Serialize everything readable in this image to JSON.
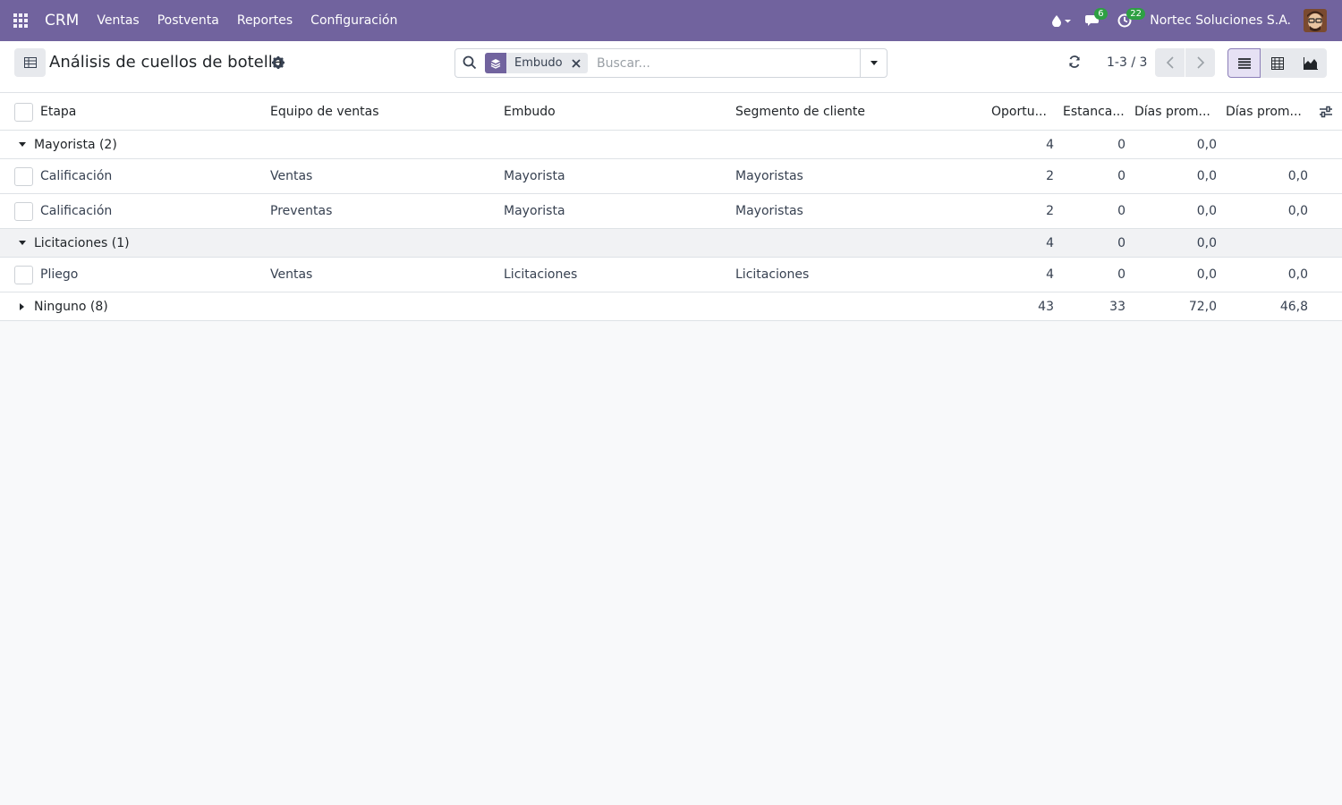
{
  "navbar": {
    "brand": "CRM",
    "menus": [
      "Ventas",
      "Postventa",
      "Reportes",
      "Configuración"
    ],
    "messages_count": "6",
    "activities_count": "22",
    "company": "Nortec Soluciones S.A.",
    "icons": [
      "apps-grid-icon",
      "droplet-icon",
      "chat-icon",
      "clock-icon",
      "avatar"
    ]
  },
  "control": {
    "title": "Análisis de cuellos de botella",
    "search": {
      "facet_label": "Embudo",
      "placeholder": "Buscar..."
    },
    "pager": "1-3 / 3",
    "views": [
      "list",
      "pivot",
      "graph"
    ],
    "active_view": "list"
  },
  "table": {
    "columns": [
      "Etapa",
      "Equipo de ventas",
      "Embudo",
      "Segmento de cliente",
      "Oportu...",
      "Estanca...",
      "Días prom...",
      "Días prom..."
    ],
    "groups": [
      {
        "label": "Mayorista (2)",
        "expanded": true,
        "totals": [
          "4",
          "0",
          "0,0",
          ""
        ],
        "rows": [
          {
            "cells": [
              "Calificación",
              "Ventas",
              "Mayorista",
              "Mayoristas"
            ],
            "nums": [
              "2",
              "0",
              "0,0",
              "0,0"
            ]
          },
          {
            "cells": [
              "Calificación",
              "Preventas",
              "Mayorista",
              "Mayoristas"
            ],
            "nums": [
              "2",
              "0",
              "0,0",
              "0,0"
            ]
          }
        ]
      },
      {
        "label": "Licitaciones (1)",
        "expanded": true,
        "totals": [
          "4",
          "0",
          "0,0",
          ""
        ],
        "rows": [
          {
            "cells": [
              "Pliego",
              "Ventas",
              "Licitaciones",
              "Licitaciones"
            ],
            "nums": [
              "4",
              "0",
              "0,0",
              "0,0"
            ]
          }
        ]
      },
      {
        "label": "Ninguno (8)",
        "expanded": false,
        "totals": [
          "43",
          "33",
          "72,0",
          "46,8"
        ],
        "rows": []
      }
    ]
  },
  "colors": {
    "navbar": "#71639e",
    "badge": "#2ea043",
    "active_view_bg": "#e6e1f4"
  }
}
